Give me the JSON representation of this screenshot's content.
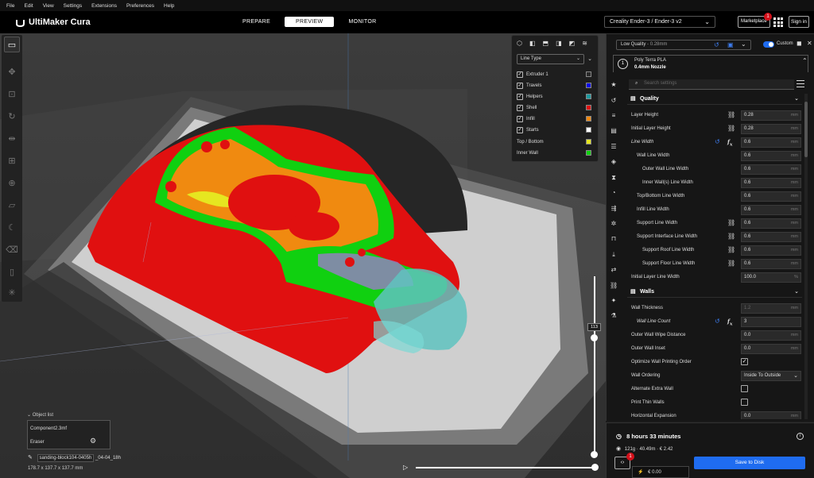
{
  "menu": [
    "File",
    "Edit",
    "View",
    "Settings",
    "Extensions",
    "Preferences",
    "Help"
  ],
  "app": {
    "logo": "UltiMaker Cura"
  },
  "stages": [
    {
      "label": "PREPARE"
    },
    {
      "label": "PREVIEW",
      "active": true
    },
    {
      "label": "MONITOR"
    }
  ],
  "header": {
    "printer": "Creality Ender-3 / Ender-3 v2",
    "marketplace": "Marketplace",
    "marketplace_badge": "1",
    "signin": "Sign in"
  },
  "view_panel": {
    "icons": [
      "cube-3d-icon",
      "cube-front-icon",
      "cube-top-icon",
      "cube-left-icon",
      "cube-right-icon",
      "xray-icon"
    ],
    "line_type": "Line Type",
    "rows": [
      {
        "label": "Extruder 1",
        "color": "#2a2a2a"
      },
      {
        "label": "Travels",
        "color": "#0a0ae6"
      },
      {
        "label": "Helpers",
        "color": "#1e9aa0"
      },
      {
        "label": "Shell",
        "color": "#e01010"
      },
      {
        "label": "Infill",
        "color": "#f08a10"
      },
      {
        "label": "Starts",
        "color": "#ffffff"
      },
      {
        "label": "Top / Bottom",
        "color": "#e6e620"
      },
      {
        "label": "Inner Wall",
        "color": "#10d010"
      }
    ]
  },
  "layer": {
    "current": "113",
    "top_fraction": 0.14
  },
  "object_list": {
    "header": "Object list",
    "items": [
      "Component2.3mf",
      "Eraser"
    ],
    "job_name": "sanding-block104-0405h",
    "job_suffix": "_04-04_18h",
    "dimensions": "178.7 x 137.7 x 137.7 mm"
  },
  "print_settings": {
    "quality": "Low Quality",
    "layer_height": "- 0.28mm",
    "custom_label": "Custom",
    "extruder_number": "1",
    "material": "Poly Terra PLA",
    "nozzle": "0.4mm Nozzle",
    "search_placeholder": "Search settings",
    "categories": [
      {
        "label": "Quality",
        "icon": "stack-icon",
        "settings": [
          {
            "label": "Layer Height",
            "value": "0.28",
            "unit": "mm",
            "indent": 0,
            "link": true
          },
          {
            "label": "Initial Layer Height",
            "value": "0.28",
            "unit": "mm",
            "indent": 0,
            "link": true
          },
          {
            "label": "Line Width",
            "value": "0.6",
            "unit": "mm",
            "indent": 0,
            "italic": true,
            "reset": true,
            "fx": true
          },
          {
            "label": "Wall Line Width",
            "value": "0.6",
            "unit": "mm",
            "indent": 1
          },
          {
            "label": "Outer Wall Line Width",
            "value": "0.6",
            "unit": "mm",
            "indent": 2
          },
          {
            "label": "Inner Wall(s) Line Width",
            "value": "0.6",
            "unit": "mm",
            "indent": 2
          },
          {
            "label": "Top/Bottom Line Width",
            "value": "0.6",
            "unit": "mm",
            "indent": 1
          },
          {
            "label": "Infill Line Width",
            "value": "0.6",
            "unit": "mm",
            "indent": 1
          },
          {
            "label": "Support Line Width",
            "value": "0.6",
            "unit": "mm",
            "indent": 1,
            "link": true
          },
          {
            "label": "Support Interface Line Width",
            "value": "0.6",
            "unit": "mm",
            "indent": 1,
            "link": true
          },
          {
            "label": "Support Roof Line Width",
            "value": "0.6",
            "unit": "mm",
            "indent": 2,
            "link": true
          },
          {
            "label": "Support Floor Line Width",
            "value": "0.6",
            "unit": "mm",
            "indent": 2,
            "link": true
          },
          {
            "label": "Initial Layer Line Width",
            "value": "100.0",
            "unit": "%",
            "indent": 0
          }
        ]
      },
      {
        "label": "Walls",
        "icon": "walls-icon",
        "settings": [
          {
            "label": "Wall Thickness",
            "value": "1.2",
            "unit": "mm",
            "indent": 0,
            "dim": true
          },
          {
            "label": "Wall Line Count",
            "value": "3",
            "unit": "",
            "indent": 1,
            "italic": true,
            "reset": true,
            "fx": true
          },
          {
            "label": "Outer Wall Wipe Distance",
            "value": "0.0",
            "unit": "mm",
            "indent": 0
          },
          {
            "label": "Outer Wall Inset",
            "value": "0.0",
            "unit": "mm",
            "indent": 0
          },
          {
            "label": "Optimize Wall Printing Order",
            "checkbox": true,
            "checked": true,
            "indent": 0
          },
          {
            "label": "Wall Ordering",
            "value": "Inside To Outside",
            "dropdown": true,
            "indent": 0
          },
          {
            "label": "Alternate Extra Wall",
            "checkbox": true,
            "checked": false,
            "indent": 0
          },
          {
            "label": "Print Thin Walls",
            "checkbox": true,
            "checked": false,
            "indent": 0
          },
          {
            "label": "Horizontal Expansion",
            "value": "0.0",
            "unit": "mm",
            "indent": 0
          }
        ]
      }
    ]
  },
  "action": {
    "time": "8 hours 33 minutes",
    "material_usage": "121g · 40.49m · € 2.42",
    "save_button": "Save to Disk",
    "preview_badge": "1",
    "cost": "€ 0.00"
  },
  "colors": {
    "accent": "#1f6cf0",
    "shell": "#e01010",
    "inner_wall": "#10d010",
    "infill": "#f08a10",
    "top_bottom": "#e6e620",
    "helpers": "#1e9aa0"
  }
}
